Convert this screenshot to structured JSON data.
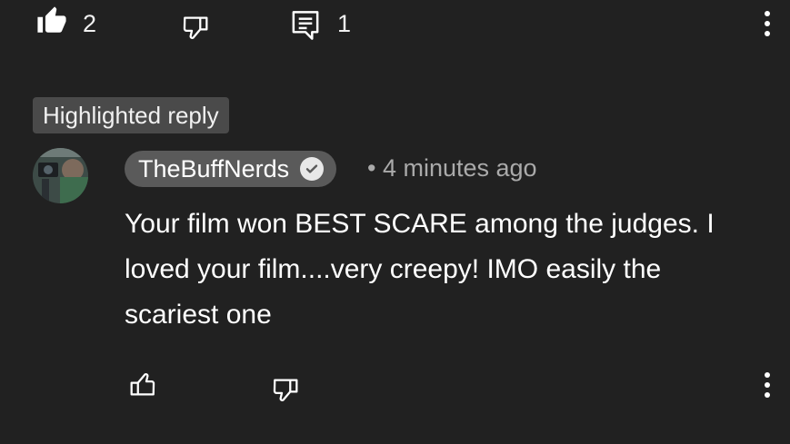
{
  "top_actions": {
    "like_count": "2",
    "reply_count": "1"
  },
  "highlight_label": "Highlighted reply",
  "comment": {
    "author": "TheBuffNerds",
    "verified": true,
    "timestamp": "• 4 minutes ago",
    "text": "Your film won BEST SCARE among the judges. I loved your film....very creepy! IMO easily the scariest one"
  },
  "icons": {
    "top_like": "thumbs-up-filled-icon",
    "top_dislike": "thumbs-down-icon",
    "top_reply": "reply-comment-icon",
    "top_menu": "more-vertical-icon",
    "verified": "verified-check-icon",
    "bottom_like": "thumbs-up-icon",
    "bottom_dislike": "thumbs-down-icon",
    "bottom_menu": "more-vertical-icon"
  },
  "colors": {
    "background": "#212121",
    "badge": "#4a4a4a",
    "author_chip": "#5a5a5a",
    "secondary_text": "#aaaaaa"
  }
}
